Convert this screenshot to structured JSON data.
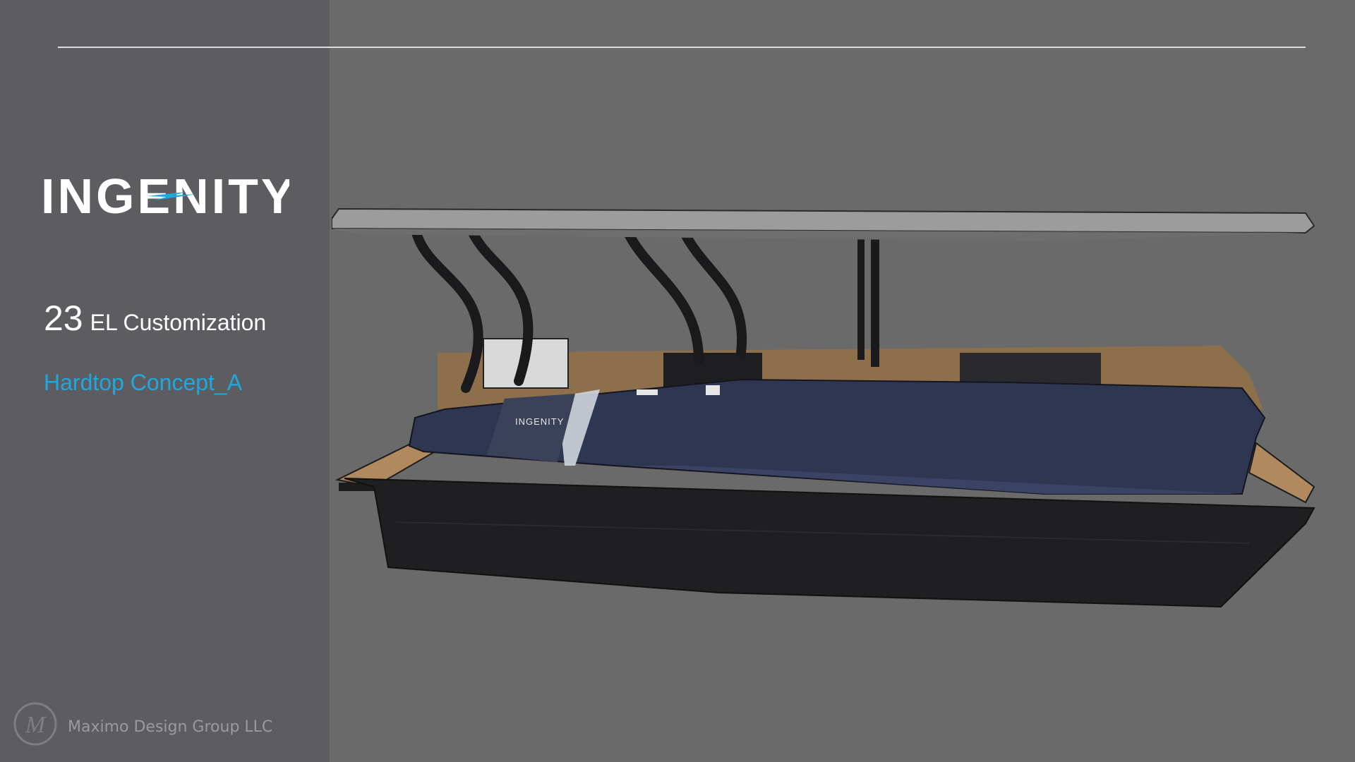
{
  "brand": {
    "logo_text": "INGENITY"
  },
  "title": {
    "model_number": "23",
    "model_label": "EL Customization",
    "concept": "Hardtop Concept_A"
  },
  "boat_image": {
    "hull_badge_text": "INGENITY"
  },
  "footer": {
    "company": "Maximo Design Group LLC",
    "logo_letter": "M"
  },
  "colors": {
    "sidebar": "#5d5d61",
    "background": "#6a6a6b",
    "accent": "#1ea8de",
    "hull_upper": "#2e3652",
    "hull_lower": "#1e1e20",
    "teak": "#a98458"
  }
}
